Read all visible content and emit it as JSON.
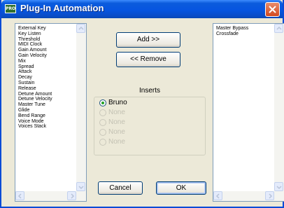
{
  "window": {
    "title": "Plug-In Automation",
    "app_icon_text": "PRO"
  },
  "available_list": {
    "items": [
      "External Key",
      "Key Listen",
      "Threshold",
      "MIDI Clock",
      "Gain Amount",
      "Gain Velocity",
      "Mix",
      "Spread",
      "Attack",
      "Decay",
      "Sustain",
      "Release",
      "Detune Amount",
      "Detune Velocity",
      "Master Tune",
      "Glide",
      "Bend Range",
      "Voice Mode",
      "Voices Stack"
    ]
  },
  "automated_list": {
    "items": [
      "Master Bypass",
      "Crossfade"
    ]
  },
  "buttons": {
    "add": "Add >>",
    "remove": "<< Remove",
    "cancel": "Cancel",
    "ok": "OK"
  },
  "inserts": {
    "label": "Inserts",
    "options": [
      {
        "label": "Bruno",
        "selected": true,
        "enabled": true
      },
      {
        "label": "None",
        "selected": false,
        "enabled": false
      },
      {
        "label": "None",
        "selected": false,
        "enabled": false
      },
      {
        "label": "None",
        "selected": false,
        "enabled": false
      },
      {
        "label": "None",
        "selected": false,
        "enabled": false
      }
    ]
  },
  "colors": {
    "titlebar": "#0755e0",
    "close": "#d2491f",
    "selected_radio": "#21a121"
  }
}
